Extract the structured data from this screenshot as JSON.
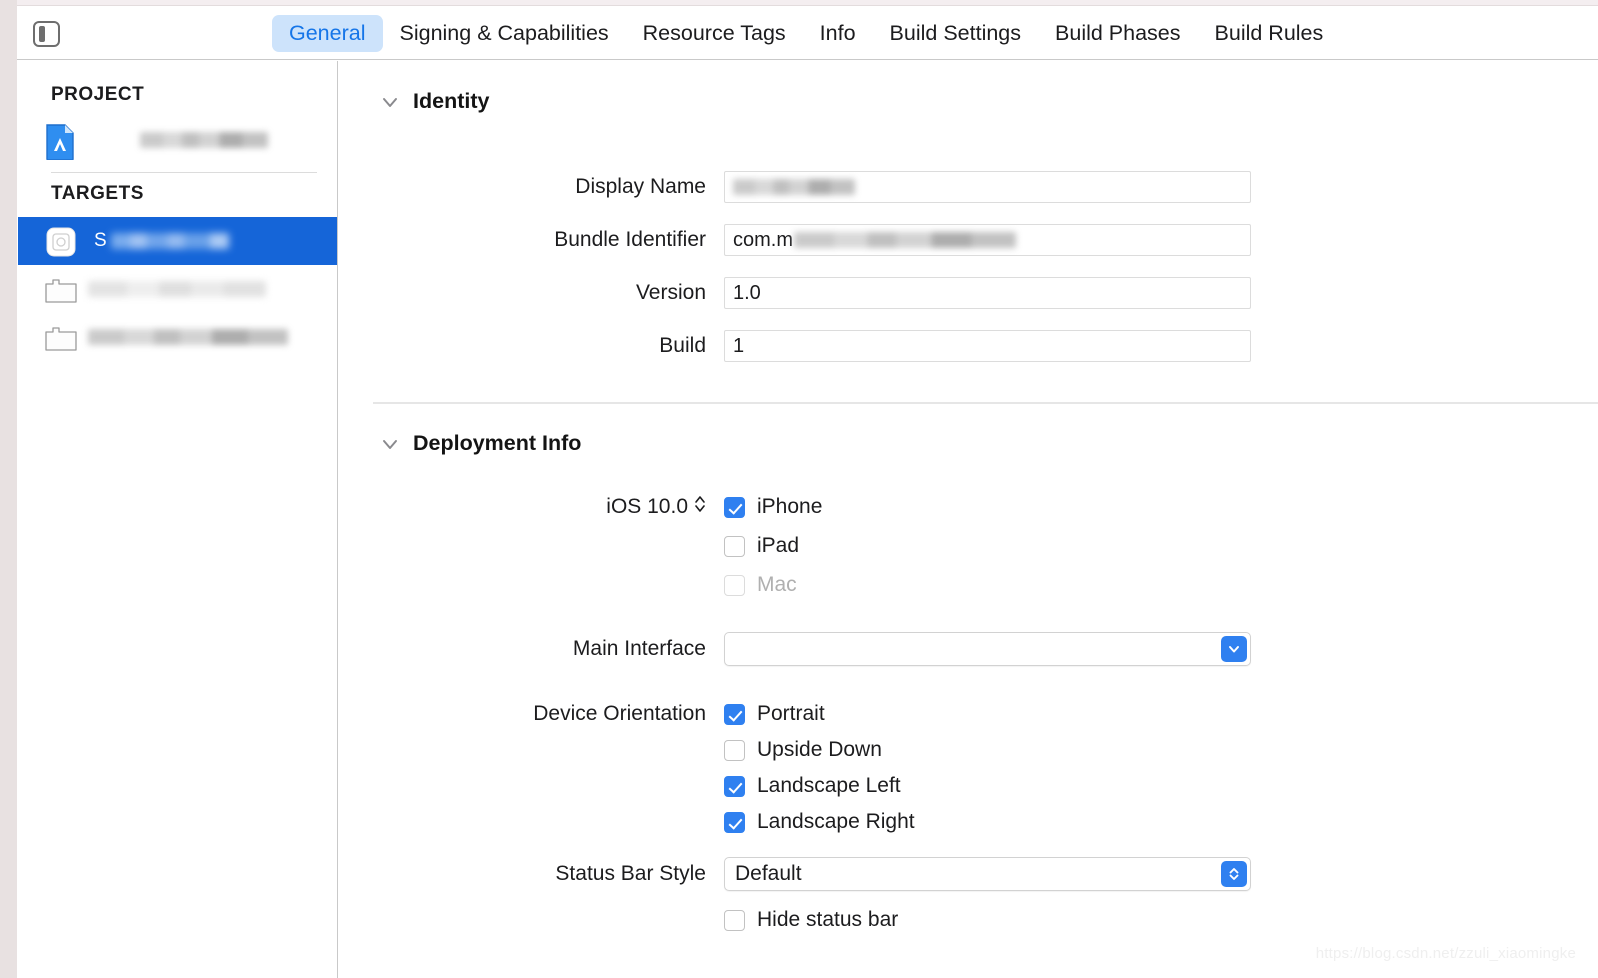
{
  "window": {
    "toolbar": {
      "sidebar_toggle_icon": "sidebar-toggle-icon"
    }
  },
  "tabs": [
    {
      "label": "General",
      "active": true
    },
    {
      "label": "Signing & Capabilities",
      "active": false
    },
    {
      "label": "Resource Tags",
      "active": false
    },
    {
      "label": "Info",
      "active": false
    },
    {
      "label": "Build Settings",
      "active": false
    },
    {
      "label": "Build Phases",
      "active": false
    },
    {
      "label": "Build Rules",
      "active": false
    }
  ],
  "sidebar": {
    "project_heading": "PROJECT",
    "targets_heading": "TARGETS",
    "project_items": [
      {
        "name": "",
        "redacted": true,
        "icon": "xcode-project-icon"
      }
    ],
    "target_items": [
      {
        "name": "S",
        "redacted": true,
        "selected": true,
        "icon": "app-icon"
      },
      {
        "name": "",
        "redacted": true,
        "selected": false,
        "icon": "extension-icon"
      },
      {
        "name": "",
        "redacted": true,
        "selected": false,
        "icon": "extension-icon"
      }
    ]
  },
  "identity": {
    "section_title": "Identity",
    "disclosure_icon": "chevron-down-icon",
    "fields": [
      {
        "label": "Display Name",
        "value": "",
        "redacted": true
      },
      {
        "label": "Bundle Identifier",
        "value": "com.m",
        "redacted": true
      },
      {
        "label": "Version",
        "value": "1.0",
        "redacted": false
      },
      {
        "label": "Build",
        "value": "1",
        "redacted": false
      }
    ]
  },
  "deployment": {
    "section_title": "Deployment Info",
    "disclosure_icon": "chevron-down-icon",
    "deployment_target": "iOS 10.0",
    "stepper_icon": "up-down-chevron-icon",
    "devices": [
      {
        "label": "iPhone",
        "checked": true,
        "disabled": false
      },
      {
        "label": "iPad",
        "checked": false,
        "disabled": false
      },
      {
        "label": "Mac",
        "checked": false,
        "disabled": true
      }
    ],
    "main_interface": {
      "label": "Main Interface",
      "value": "",
      "button_icon": "chevron-down-icon"
    },
    "device_orientation": {
      "label": "Device Orientation",
      "options": [
        {
          "label": "Portrait",
          "checked": true
        },
        {
          "label": "Upside Down",
          "checked": false
        },
        {
          "label": "Landscape Left",
          "checked": true
        },
        {
          "label": "Landscape Right",
          "checked": true
        }
      ]
    },
    "status_bar_style": {
      "label": "Status Bar Style",
      "value": "Default",
      "button_icon": "up-down-chevron-icon"
    },
    "hide_status_bar": {
      "label": "Hide status bar",
      "checked": false
    }
  },
  "watermark": "https://blog.csdn.net/zzuli_xiaomingke",
  "colors": {
    "accent_blue": "#2f80f0",
    "selection_blue": "#1565d8",
    "active_tab_bg": "#cde3fb",
    "active_tab_fg": "#1575e8"
  }
}
